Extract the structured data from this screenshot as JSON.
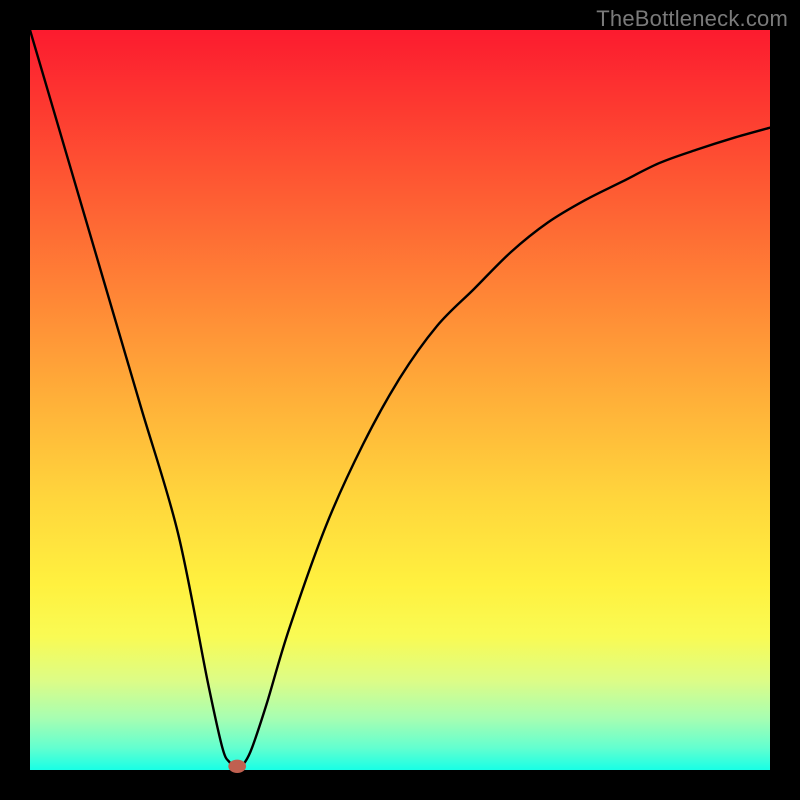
{
  "watermark": "TheBottleneck.com",
  "chart_data": {
    "type": "line",
    "title": "",
    "xlabel": "",
    "ylabel": "",
    "xlim": [
      0,
      100
    ],
    "ylim": [
      0,
      100
    ],
    "grid": false,
    "legend": false,
    "series": [
      {
        "name": "bottleneck-curve",
        "x": [
          0,
          5,
          10,
          15,
          20,
          24,
          26,
          27,
          28,
          29,
          30,
          32,
          35,
          40,
          45,
          50,
          55,
          60,
          65,
          70,
          75,
          80,
          85,
          90,
          95,
          100
        ],
        "y": [
          100,
          83,
          66,
          49,
          32,
          12,
          3,
          1,
          0,
          1,
          3,
          9,
          19,
          33,
          44,
          53,
          60,
          65,
          70,
          74,
          77,
          79.5,
          82,
          83.8,
          85.4,
          86.8
        ]
      }
    ],
    "marker": {
      "x": 28,
      "y": 0.5,
      "rx": 1.2,
      "ry": 0.9,
      "color": "#c06050"
    },
    "gradient_stops": [
      {
        "pct": 0,
        "color": "#fc1b2f"
      },
      {
        "pct": 9,
        "color": "#fd3530"
      },
      {
        "pct": 22,
        "color": "#fe5c33"
      },
      {
        "pct": 36,
        "color": "#ff8636"
      },
      {
        "pct": 50,
        "color": "#ffb039"
      },
      {
        "pct": 63,
        "color": "#ffd53c"
      },
      {
        "pct": 75,
        "color": "#fff13f"
      },
      {
        "pct": 82,
        "color": "#f9fb54"
      },
      {
        "pct": 88,
        "color": "#dcfc87"
      },
      {
        "pct": 93,
        "color": "#a7feb2"
      },
      {
        "pct": 97,
        "color": "#63ffcf"
      },
      {
        "pct": 100,
        "color": "#18ffe5"
      }
    ]
  }
}
